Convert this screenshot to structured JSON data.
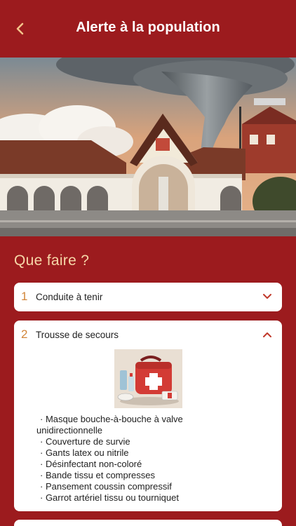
{
  "header": {
    "title": "Alerte à la population",
    "back_icon": "chevron-left-icon"
  },
  "hero": {
    "image": "tornado-over-building-illustration"
  },
  "section": {
    "title": "Que faire ?"
  },
  "accordion": [
    {
      "number": "1",
      "label": "Conduite à tenir",
      "expanded": false,
      "icon": "chevron-down-icon"
    },
    {
      "number": "2",
      "label": "Trousse de secours",
      "expanded": true,
      "icon": "chevron-up-icon",
      "image": "first-aid-kit-illustration",
      "items": [
        "· Masque bouche-à-bouche à valve",
        "unidirectionnelle",
        "· Couverture de survie",
        "· Gants latex ou nitrile",
        "· Désinfectant non-coloré",
        "· Bande tissu et compresses",
        "· Pansement coussin compressif",
        "· Garrot artériel tissu ou tourniquet"
      ]
    }
  ],
  "colors": {
    "background": "#9c1b1e",
    "accent": "#d2863a",
    "section_title": "#f6d7a8",
    "card": "#ffffff"
  }
}
